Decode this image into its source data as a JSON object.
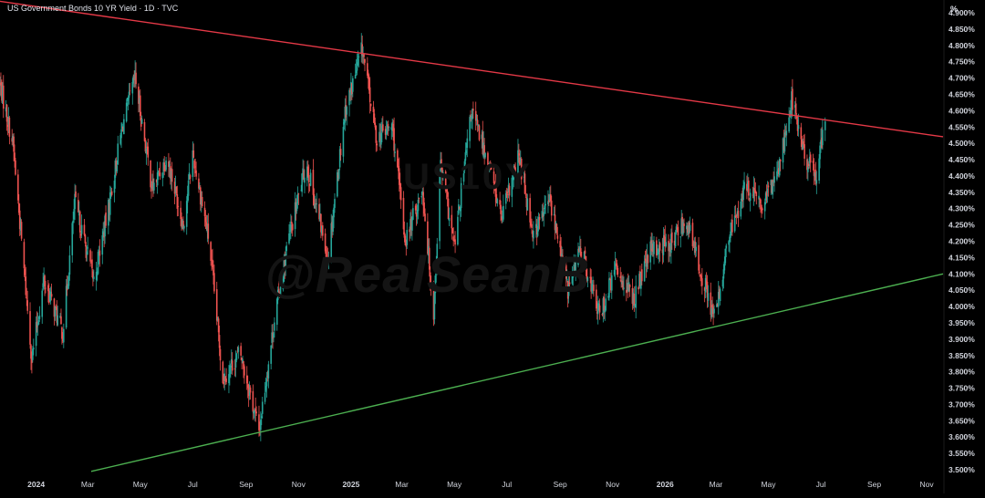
{
  "header": {
    "symbol_title": "US Government Bonds 10 YR Yield · 1D · TVC",
    "unit_label": "%"
  },
  "watermark": {
    "symbol": "US10Y",
    "handle": "@RealSeanB"
  },
  "colors": {
    "background": "#000000",
    "up_candle": "#26a69a",
    "down_candle": "#ef5350",
    "resistance_line": "#e53947",
    "support_line": "#4caf50",
    "axis_text": "#d1d4dc"
  },
  "chart_data": {
    "type": "candlestick",
    "title": "US Government Bonds 10 YR Yield · 1D · TVC",
    "xlabel": "",
    "ylabel": "",
    "ylim": [
      3.5,
      4.9
    ],
    "y_ticks": [
      "4.900%",
      "4.850%",
      "4.800%",
      "4.750%",
      "4.700%",
      "4.650%",
      "4.600%",
      "4.550%",
      "4.500%",
      "4.450%",
      "4.400%",
      "4.350%",
      "4.300%",
      "4.250%",
      "4.200%",
      "4.150%",
      "4.100%",
      "4.050%",
      "4.000%",
      "3.950%",
      "3.900%",
      "3.850%",
      "3.800%",
      "3.750%",
      "3.700%",
      "3.650%",
      "3.600%",
      "3.550%",
      "3.500%"
    ],
    "x_ticks": [
      {
        "label": "2024",
        "date": "2024-01-01",
        "bold": true
      },
      {
        "label": "Mar",
        "date": "2024-03-01"
      },
      {
        "label": "May",
        "date": "2024-05-01"
      },
      {
        "label": "Jul",
        "date": "2024-07-01"
      },
      {
        "label": "Sep",
        "date": "2024-09-01"
      },
      {
        "label": "Nov",
        "date": "2024-11-01"
      },
      {
        "label": "2025",
        "date": "2025-01-01",
        "bold": true
      },
      {
        "label": "Mar",
        "date": "2025-03-01"
      },
      {
        "label": "May",
        "date": "2025-05-01"
      },
      {
        "label": "Jul",
        "date": "2025-07-01"
      },
      {
        "label": "Sep",
        "date": "2025-09-01"
      },
      {
        "label": "Nov",
        "date": "2025-11-01"
      },
      {
        "label": "2026",
        "date": "2026-01-01",
        "bold": true
      },
      {
        "label": "Mar",
        "date": "2026-03-01"
      },
      {
        "label": "May",
        "date": "2026-05-01"
      },
      {
        "label": "Jul",
        "date": "2026-07-01"
      },
      {
        "label": "Sep",
        "date": "2026-09-01"
      },
      {
        "label": "Nov",
        "date": "2026-11-01"
      }
    ],
    "x_range": [
      "2023-11-20",
      "2026-11-20"
    ],
    "price_path": [
      {
        "date": "2023-11-20",
        "value": 4.68
      },
      {
        "date": "2023-12-05",
        "value": 4.5
      },
      {
        "date": "2023-12-27",
        "value": 3.84
      },
      {
        "date": "2024-01-10",
        "value": 4.08
      },
      {
        "date": "2024-02-01",
        "value": 3.92
      },
      {
        "date": "2024-02-15",
        "value": 4.32
      },
      {
        "date": "2024-03-08",
        "value": 4.08
      },
      {
        "date": "2024-03-25",
        "value": 4.3
      },
      {
        "date": "2024-04-10",
        "value": 4.55
      },
      {
        "date": "2024-04-25",
        "value": 4.7
      },
      {
        "date": "2024-05-15",
        "value": 4.36
      },
      {
        "date": "2024-06-01",
        "value": 4.46
      },
      {
        "date": "2024-06-20",
        "value": 4.25
      },
      {
        "date": "2024-07-01",
        "value": 4.47
      },
      {
        "date": "2024-07-20",
        "value": 4.2
      },
      {
        "date": "2024-08-05",
        "value": 3.78
      },
      {
        "date": "2024-08-25",
        "value": 3.86
      },
      {
        "date": "2024-09-16",
        "value": 3.62
      },
      {
        "date": "2024-10-05",
        "value": 3.98
      },
      {
        "date": "2024-10-20",
        "value": 4.2
      },
      {
        "date": "2024-11-10",
        "value": 4.44
      },
      {
        "date": "2024-12-05",
        "value": 4.15
      },
      {
        "date": "2024-12-25",
        "value": 4.6
      },
      {
        "date": "2025-01-14",
        "value": 4.79
      },
      {
        "date": "2025-01-30",
        "value": 4.52
      },
      {
        "date": "2025-02-18",
        "value": 4.55
      },
      {
        "date": "2025-03-05",
        "value": 4.2
      },
      {
        "date": "2025-03-25",
        "value": 4.36
      },
      {
        "date": "2025-04-07",
        "value": 3.98
      },
      {
        "date": "2025-04-15",
        "value": 4.44
      },
      {
        "date": "2025-05-01",
        "value": 4.18
      },
      {
        "date": "2025-05-21",
        "value": 4.6
      },
      {
        "date": "2025-06-10",
        "value": 4.44
      },
      {
        "date": "2025-06-25",
        "value": 4.27
      },
      {
        "date": "2025-07-15",
        "value": 4.46
      },
      {
        "date": "2025-08-01",
        "value": 4.22
      },
      {
        "date": "2025-08-20",
        "value": 4.33
      },
      {
        "date": "2025-09-10",
        "value": 4.05
      },
      {
        "date": "2025-09-25",
        "value": 4.18
      },
      {
        "date": "2025-10-17",
        "value": 3.97
      },
      {
        "date": "2025-11-05",
        "value": 4.12
      },
      {
        "date": "2025-11-25",
        "value": 4.02
      },
      {
        "date": "2025-12-15",
        "value": 4.17
      },
      {
        "date": "2026-01-10",
        "value": 4.2
      },
      {
        "date": "2026-01-25",
        "value": 4.27
      },
      {
        "date": "2026-02-10",
        "value": 4.12
      },
      {
        "date": "2026-02-28",
        "value": 3.96
      },
      {
        "date": "2026-03-15",
        "value": 4.2
      },
      {
        "date": "2026-04-05",
        "value": 4.37
      },
      {
        "date": "2026-04-25",
        "value": 4.3
      },
      {
        "date": "2026-05-15",
        "value": 4.45
      },
      {
        "date": "2026-05-28",
        "value": 4.64
      },
      {
        "date": "2026-06-12",
        "value": 4.46
      },
      {
        "date": "2026-06-25",
        "value": 4.4
      },
      {
        "date": "2026-07-06",
        "value": 4.57
      }
    ],
    "trendlines": [
      {
        "name": "resistance",
        "color": "#e53947",
        "start": {
          "date": "2023-11-20",
          "value": 4.935
        },
        "end": {
          "date": "2026-11-20",
          "value": 4.52
        }
      },
      {
        "name": "support",
        "color": "#4caf50",
        "start": {
          "date": "2024-03-05",
          "value": 3.495
        },
        "end": {
          "date": "2026-11-20",
          "value": 4.1
        }
      }
    ],
    "grid": false,
    "legend": "none"
  }
}
